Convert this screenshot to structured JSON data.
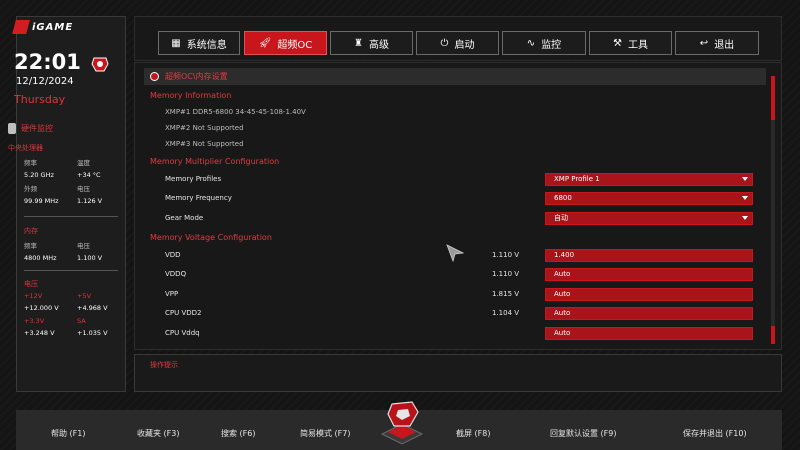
{
  "brand": {
    "logo_text": "iGAME"
  },
  "status": {
    "time": "22:01",
    "date": "12/12/2024",
    "weekday": "Thursday"
  },
  "hardware_monitor": {
    "title": "硬件监控",
    "cpu": {
      "label": "中央处理器",
      "freq_label": "频率",
      "freq_value": "5.20 GHz",
      "temp_label": "温度",
      "temp_value": "+34 °C",
      "bclk_label": "外频",
      "bclk_value": "99.99 MHz",
      "volt_label": "电压",
      "volt_value": "1.126 V"
    },
    "memory": {
      "label": "内存",
      "freq_label": "频率",
      "freq_value": "4800 MHz",
      "volt_label": "电压",
      "volt_value": "1.100 V"
    },
    "voltage": {
      "label": "电压",
      "v12_label": "+12V",
      "v12_value": "+12.000 V",
      "v5_label": "+5V",
      "v5_value": "+4.968 V",
      "v33_label": "+3.3V",
      "v33_value": "+3.248 V",
      "sa_label": "SA",
      "sa_value": "+1.035 V"
    }
  },
  "nav": {
    "tabs": [
      {
        "label": "系统信息",
        "icon": "grid-icon"
      },
      {
        "label": "超频OC",
        "icon": "rocket-icon",
        "active": true
      },
      {
        "label": "高级",
        "icon": "castle-icon"
      },
      {
        "label": "启动",
        "icon": "power-icon"
      },
      {
        "label": "监控",
        "icon": "monitor-wave-icon"
      },
      {
        "label": "工具",
        "icon": "toolbox-icon"
      },
      {
        "label": "退出",
        "icon": "return-arrow-icon"
      }
    ]
  },
  "main": {
    "breadcrumb": "超频OC\\内存设置",
    "memory_info": {
      "title": "Memory Information",
      "xmp1": "XMP#1 DDR5-6800 34-45-45-108-1.40V",
      "xmp2": "XMP#2 Not Supported",
      "xmp3": "XMP#3 Not Supported"
    },
    "multiplier": {
      "title": "Memory Multiplier Configuration",
      "profiles_label": "Memory Profiles",
      "profiles_value": "XMP Profile 1",
      "frequency_label": "Memory Frequency",
      "frequency_value": "6800",
      "gear_label": "Gear Mode",
      "gear_value": "自动"
    },
    "voltage": {
      "title": "Memory Voltage Configuration",
      "vdd_label": "VDD",
      "vdd_current": "1.110 V",
      "vdd_value": "1.400",
      "vddq_label": "VDDQ",
      "vddq_current": "1.110 V",
      "vddq_value": "Auto",
      "vpp_label": "VPP",
      "vpp_current": "1.815 V",
      "vpp_value": "Auto",
      "cpuvdd2_label": "CPU VDD2",
      "cpuvdd2_current": "1.104 V",
      "cpuvdd2_value": "Auto",
      "cpuvddq_label": "CPU Vddq",
      "cpuvddq_value": "Auto"
    }
  },
  "help": {
    "title": "操作提示"
  },
  "footer": {
    "help": "帮助 (F1)",
    "favorites": "收藏夹 (F3)",
    "search": "搜索 (F6)",
    "easy_mode": "简易模式 (F7)",
    "screenshot": "截屏 (F8)",
    "restore_defaults": "回复默认设置 (F9)",
    "save_exit": "保存并退出 (F10)"
  },
  "colors": {
    "accent": "#c8161c",
    "accent_text": "#e23b41",
    "background": "#151515"
  }
}
